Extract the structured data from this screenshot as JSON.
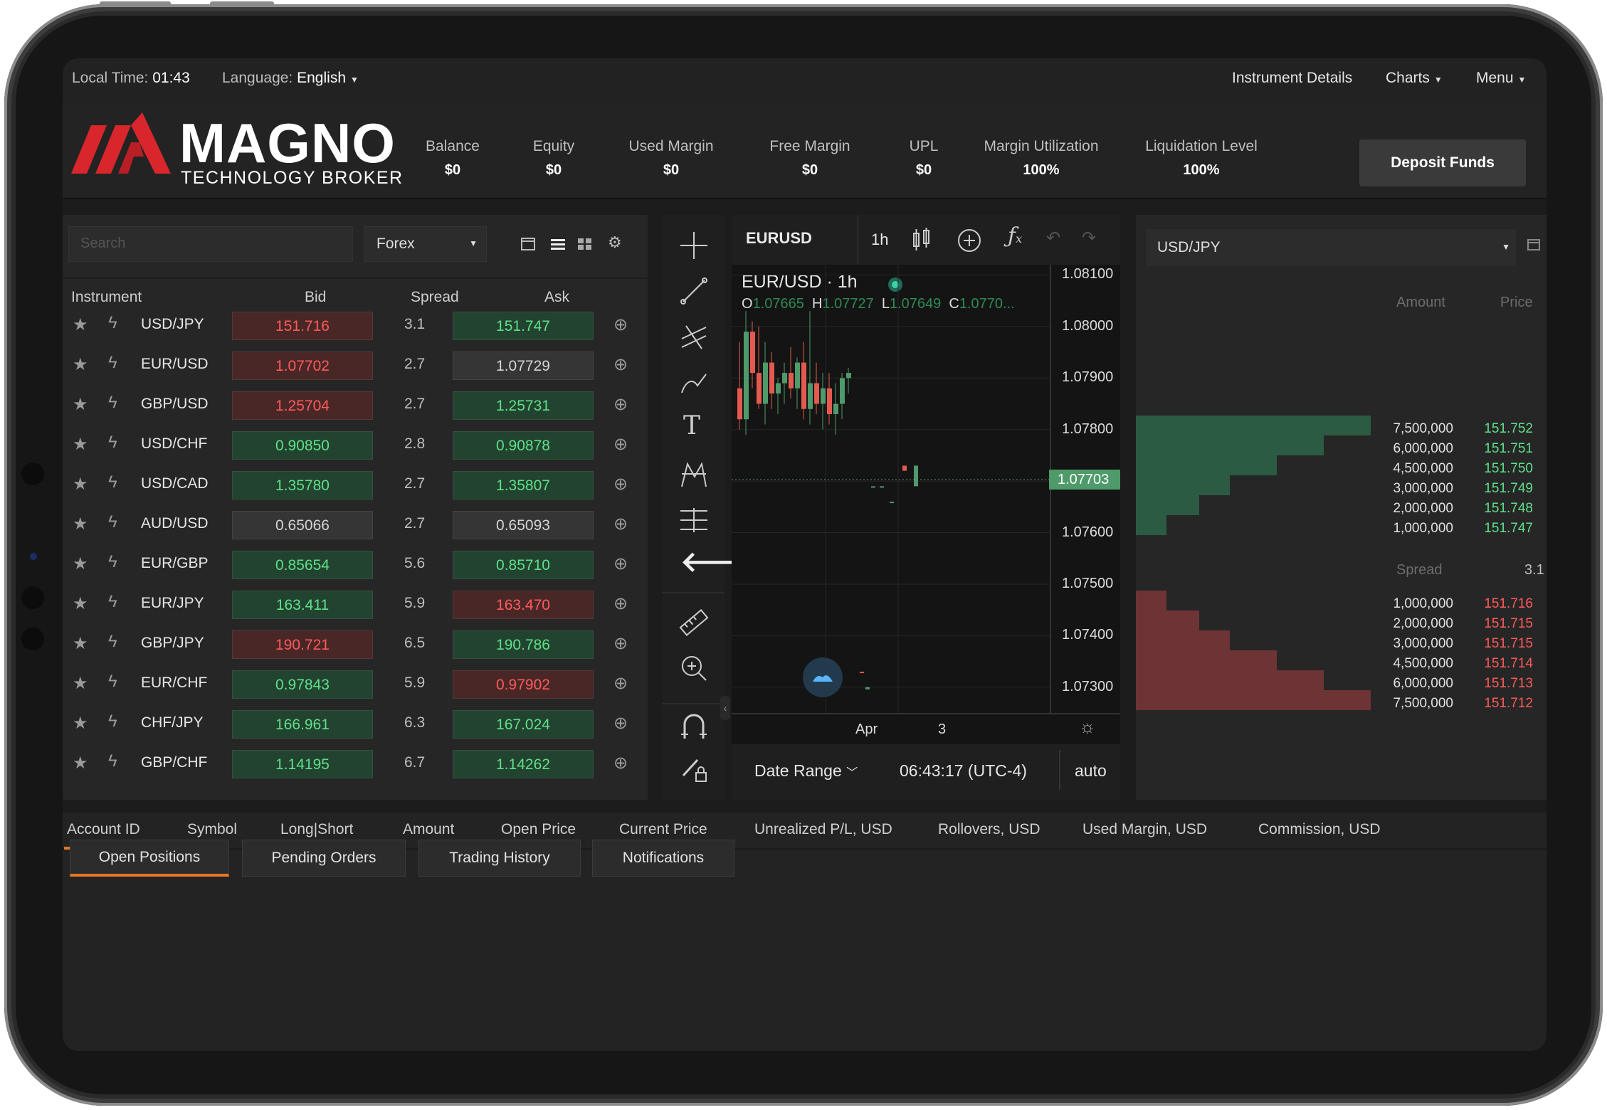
{
  "topbar": {
    "local_time_label": "Local Time:",
    "local_time": "01:43",
    "language_label": "Language:",
    "language": "English",
    "instrument_details": "Instrument Details",
    "charts": "Charts",
    "menu": "Menu"
  },
  "brand": {
    "name": "MAGNO",
    "tagline": "TECHNOLOGY BROKER"
  },
  "stats": [
    {
      "label": "Balance",
      "value": "$0"
    },
    {
      "label": "Equity",
      "value": "$0"
    },
    {
      "label": "Used Margin",
      "value": "$0"
    },
    {
      "label": "Free Margin",
      "value": "$0"
    },
    {
      "label": "UPL",
      "value": "$0"
    },
    {
      "label": "Margin Utilization",
      "value": "100%"
    },
    {
      "label": "Liquidation Level",
      "value": "100%"
    }
  ],
  "deposit_label": "Deposit Funds",
  "watchlist": {
    "search_placeholder": "Search",
    "category": "Forex",
    "headers": {
      "instrument": "Instrument",
      "bid": "Bid",
      "spread": "Spread",
      "ask": "Ask"
    },
    "rows": [
      {
        "symbol": "USD/JPY",
        "bid": "151.716",
        "bid_state": "red",
        "spread": "3.1",
        "ask": "151.747",
        "ask_state": "green"
      },
      {
        "symbol": "EUR/USD",
        "bid": "1.07702",
        "bid_state": "red",
        "spread": "2.7",
        "ask": "1.07729",
        "ask_state": "grey"
      },
      {
        "symbol": "GBP/USD",
        "bid": "1.25704",
        "bid_state": "red",
        "spread": "2.7",
        "ask": "1.25731",
        "ask_state": "green"
      },
      {
        "symbol": "USD/CHF",
        "bid": "0.90850",
        "bid_state": "green",
        "spread": "2.8",
        "ask": "0.90878",
        "ask_state": "green"
      },
      {
        "symbol": "USD/CAD",
        "bid": "1.35780",
        "bid_state": "green",
        "spread": "2.7",
        "ask": "1.35807",
        "ask_state": "green"
      },
      {
        "symbol": "AUD/USD",
        "bid": "0.65066",
        "bid_state": "grey",
        "spread": "2.7",
        "ask": "0.65093",
        "ask_state": "grey"
      },
      {
        "symbol": "EUR/GBP",
        "bid": "0.85654",
        "bid_state": "green",
        "spread": "5.6",
        "ask": "0.85710",
        "ask_state": "green"
      },
      {
        "symbol": "EUR/JPY",
        "bid": "163.411",
        "bid_state": "green",
        "spread": "5.9",
        "ask": "163.470",
        "ask_state": "red"
      },
      {
        "symbol": "GBP/JPY",
        "bid": "190.721",
        "bid_state": "red",
        "spread": "6.5",
        "ask": "190.786",
        "ask_state": "green"
      },
      {
        "symbol": "EUR/CHF",
        "bid": "0.97843",
        "bid_state": "green",
        "spread": "5.9",
        "ask": "0.97902",
        "ask_state": "red"
      },
      {
        "symbol": "CHF/JPY",
        "bid": "166.961",
        "bid_state": "green",
        "spread": "6.3",
        "ask": "167.024",
        "ask_state": "green"
      },
      {
        "symbol": "GBP/CHF",
        "bid": "1.14195",
        "bid_state": "green",
        "spread": "6.7",
        "ask": "1.14262",
        "ask_state": "green"
      }
    ]
  },
  "chart": {
    "symbol": "EURUSD",
    "interval": "1h",
    "title": "EUR/USD · 1h",
    "ohlc": {
      "o_label": "O",
      "o": "1.07665",
      "h_label": "H",
      "h": "1.07727",
      "l_label": "L",
      "l": "1.07649",
      "c_label": "C",
      "c": "1.0770..."
    },
    "price_axis": [
      "1.08100",
      "1.08000",
      "1.07900",
      "1.07800",
      "1.07700",
      "1.07600",
      "1.07500",
      "1.07400",
      "1.07300"
    ],
    "current_price": "1.07703",
    "x_labels": [
      "Apr",
      "3"
    ],
    "date_range": "Date Range",
    "clock": "06:43:17 (UTC-4)",
    "auto": "auto"
  },
  "chart_data": {
    "type": "candlestick",
    "y_min": 1.0725,
    "y_max": 1.0812,
    "candles": [
      [
        1.0788,
        1.0797,
        1.078,
        1.0782
      ],
      [
        1.0782,
        1.0803,
        1.0779,
        1.0799
      ],
      [
        1.0799,
        1.0801,
        1.0788,
        1.0791
      ],
      [
        1.0791,
        1.08,
        1.0784,
        1.0785
      ],
      [
        1.0785,
        1.0797,
        1.0781,
        1.0793
      ],
      [
        1.0793,
        1.0795,
        1.0784,
        1.0787
      ],
      [
        1.0787,
        1.079,
        1.0783,
        1.0789
      ],
      [
        1.0789,
        1.0793,
        1.0785,
        1.0791
      ],
      [
        1.0791,
        1.0796,
        1.0786,
        1.0788
      ],
      [
        1.0788,
        1.0794,
        1.0784,
        1.0793
      ],
      [
        1.0793,
        1.0797,
        1.0782,
        1.0784
      ],
      [
        1.0784,
        1.0803,
        1.0781,
        1.0789
      ],
      [
        1.0789,
        1.0793,
        1.0783,
        1.0785
      ],
      [
        1.0785,
        1.0791,
        1.078,
        1.0788
      ],
      [
        1.0788,
        1.0791,
        1.0781,
        1.0783
      ],
      [
        1.0783,
        1.0789,
        1.0779,
        1.0785
      ],
      [
        1.0785,
        1.0791,
        1.0782,
        1.079
      ],
      [
        1.079,
        1.0792,
        1.0787,
        1.0791
      ]
    ],
    "sparse": [
      [
        1.0769,
        1.0769
      ],
      [
        1.0769,
        1.0769
      ],
      [
        1.0766,
        1.0766
      ],
      [
        1.0773,
        1.0772
      ],
      [
        1.0769,
        1.0773
      ]
    ]
  },
  "orderbook": {
    "symbol": "USD/JPY",
    "amount_header": "Amount",
    "price_header": "Price",
    "asks": [
      {
        "amount": "7,500,000",
        "price": "151.752",
        "depth": 1.0
      },
      {
        "amount": "6,000,000",
        "price": "151.751",
        "depth": 0.8
      },
      {
        "amount": "4,500,000",
        "price": "151.750",
        "depth": 0.6
      },
      {
        "amount": "3,000,000",
        "price": "151.749",
        "depth": 0.4
      },
      {
        "amount": "2,000,000",
        "price": "151.748",
        "depth": 0.27
      },
      {
        "amount": "1,000,000",
        "price": "151.747",
        "depth": 0.13
      }
    ],
    "spread_label": "Spread",
    "spread": "3.1",
    "bids": [
      {
        "amount": "1,000,000",
        "price": "151.716",
        "depth": 0.13
      },
      {
        "amount": "2,000,000",
        "price": "151.715",
        "depth": 0.27
      },
      {
        "amount": "3,000,000",
        "price": "151.715",
        "depth": 0.4
      },
      {
        "amount": "4,500,000",
        "price": "151.714",
        "depth": 0.6
      },
      {
        "amount": "6,000,000",
        "price": "151.713",
        "depth": 0.8
      },
      {
        "amount": "7,500,000",
        "price": "151.712",
        "depth": 1.0
      }
    ]
  },
  "positions": {
    "columns": [
      "Account ID",
      "Symbol",
      "Long|Short",
      "Amount",
      "Open Price",
      "Current Price",
      "Unrealized P/L, USD",
      "Rollovers, USD",
      "Used Margin, USD",
      "Commission, USD"
    ],
    "tabs": [
      "Open Positions",
      "Pending Orders",
      "Trading History",
      "Notifications"
    ]
  },
  "colors": {
    "accent": "#e87722",
    "buy": "#5fe08a",
    "sell": "#ff5a5a",
    "logo_red": "#d8262c"
  }
}
